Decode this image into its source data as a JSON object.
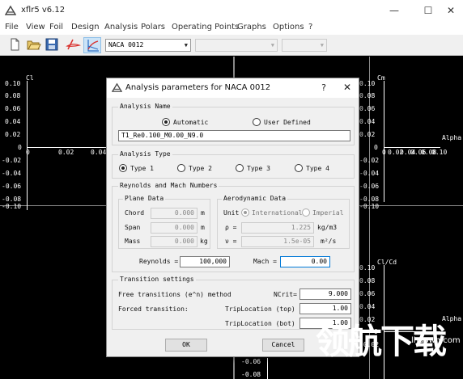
{
  "window": {
    "title": "xflr5 v6.12",
    "minimize_glyph": "—",
    "maximize_glyph": "☐",
    "close_glyph": "✕"
  },
  "menu": [
    "File",
    "View",
    "Foil",
    "Design",
    "Analysis",
    "Polars",
    "Operating Points",
    "Graphs",
    "Options",
    "?"
  ],
  "toolbar": {
    "foil_combo": "NACA 0012",
    "combo_arrow": "▼"
  },
  "graphs": {
    "cl_label": "Cl",
    "cm_label": "Cm",
    "clcd_label": "Cl/Cd",
    "alpha_label": "Alpha",
    "cl_y_ticks": [
      "0.10",
      "0.08",
      "0.06",
      "0.04",
      "0.02",
      "0",
      "-0.02",
      "-0.04",
      "-0.06",
      "-0.08",
      "-0.10"
    ],
    "cl_x_ticks": [
      "0",
      "0.02",
      "0.04"
    ],
    "cm_y_ticks": [
      "0.10",
      "0.08",
      "0.06",
      "0.04",
      "0.02",
      "0",
      "-0.02",
      "-0.04",
      "-0.06",
      "-0.08",
      "-0.10"
    ],
    "cm_x_ticks": [
      "0",
      "0.02",
      "0.04",
      "0.06",
      "0.08",
      "0.10"
    ],
    "clcd_y_ticks": [
      "0.10",
      "0.08",
      "0.06",
      "0.04",
      "0.02",
      "0",
      "-0.02"
    ],
    "bottom_y_ticks": [
      "-0.06",
      "-0.08"
    ]
  },
  "dialog": {
    "title": "Analysis parameters for NACA 0012",
    "help_glyph": "?",
    "close_glyph": "✕",
    "analysis_name": {
      "group_label": "Analysis Name",
      "automatic": "Automatic",
      "user_defined": "User Defined",
      "name_value": "T1_Re0.100_M0.00_N9.0"
    },
    "analysis_type": {
      "group_label": "Analysis Type",
      "types": [
        "Type 1",
        "Type 2",
        "Type 3",
        "Type 4"
      ]
    },
    "reynolds_mach": {
      "group_label": "Reynolds and Mach Numbers",
      "plane_data_label": "Plane Data",
      "chord_label": "Chord",
      "chord_value": "0.000",
      "chord_unit": "m",
      "span_label": "Span",
      "span_value": "0.000",
      "span_unit": "m",
      "mass_label": "Mass",
      "mass_value": "0.000",
      "mass_unit": "kg",
      "aero_data_label": "Aerodynamic Data",
      "unit_label": "Unit",
      "international": "International",
      "imperial": "Imperial",
      "rho_label": "ρ =",
      "rho_value": "1.225",
      "rho_unit": "kg/m3",
      "nu_label": "ν =",
      "nu_value": "1.5e-05",
      "nu_unit": "m²/s",
      "reynolds_label": "Reynolds =",
      "reynolds_value": "100,000",
      "mach_label": "Mach =",
      "mach_value": "0.00"
    },
    "transition": {
      "group_label": "Transition settings",
      "free_label": "Free transitions (e^n) method",
      "ncrit_label": "NCrit=",
      "ncrit_value": "9.000",
      "forced_label": "Forced transition:",
      "trip_top_label": "TripLocation (top)",
      "trip_top_value": "1.00",
      "trip_bot_label": "TripLocation (bot)",
      "trip_bot_value": "1.00"
    },
    "ok_label": "OK",
    "cancel_label": "Cancel"
  },
  "watermark": {
    "big": "领航下载",
    "small": "lhdown.com"
  },
  "colors": {
    "graph_bg": "#000000",
    "accent_red": "#d9302c",
    "accent_blue": "#2a6cc4",
    "focus_border": "#0078d7"
  }
}
